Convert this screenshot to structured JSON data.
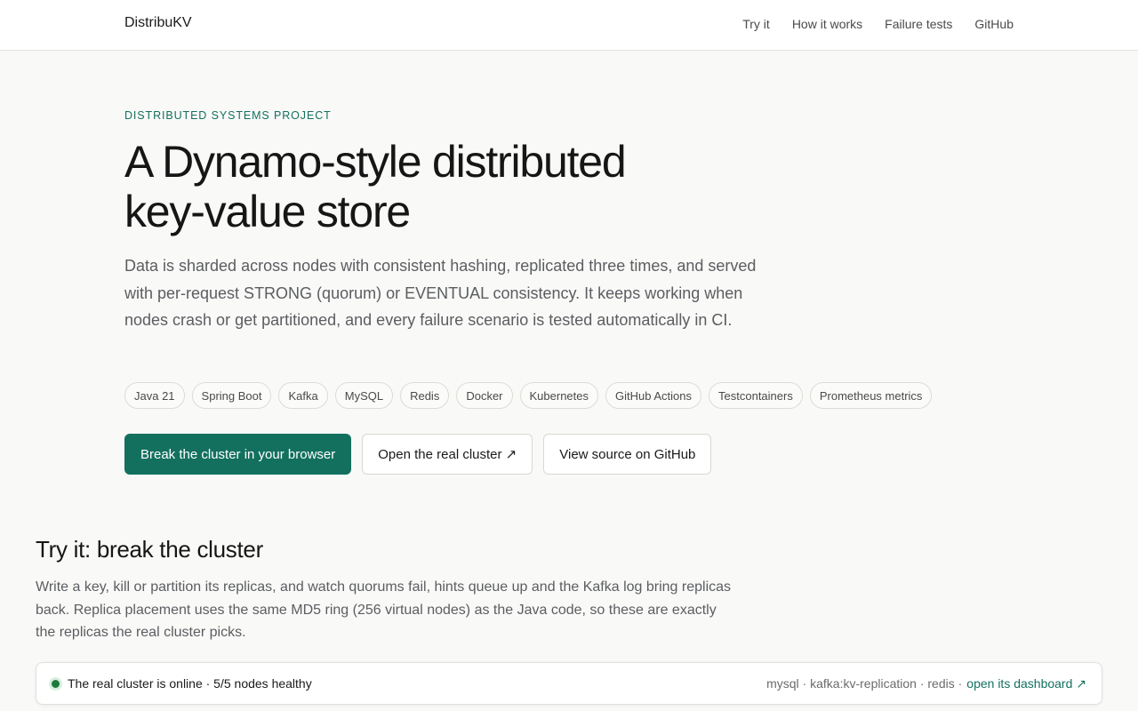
{
  "header": {
    "brand": "DistribuKV",
    "nav": [
      "Try it",
      "How it works",
      "Failure tests",
      "GitHub"
    ]
  },
  "hero": {
    "eyebrow": "DISTRIBUTED SYSTEMS PROJECT",
    "title_line1": "A Dynamo-style distributed",
    "title_line2": "key-value store",
    "lead": "Data is sharded across nodes with consistent hashing, replicated three times, and served with per-request STRONG (quorum) or EVENTUAL consistency. It keeps working when nodes crash or get partitioned, and every failure scenario is tested automatically in CI.",
    "tags": [
      "Java 21",
      "Spring Boot",
      "Kafka",
      "MySQL",
      "Redis",
      "Docker",
      "Kubernetes",
      "GitHub Actions",
      "Testcontainers",
      "Prometheus metrics"
    ],
    "cta_primary": "Break the cluster in your browser",
    "cta_cluster": "Open the real cluster ↗",
    "cta_github": "View source on GitHub"
  },
  "try_it": {
    "title": "Try it: break the cluster",
    "lead": "Write a key, kill or partition its replicas, and watch quorums fail, hints queue up and the Kafka log bring replicas back. Replica placement uses the same MD5 ring (256 virtual nodes) as the Java code, so these are exactly the replicas the real cluster picks.",
    "status": {
      "text": "The real cluster is online · 5/5 nodes healthy",
      "services": "mysql · kafka:kv-replication · redis ·",
      "dashboard_link": "open its dashboard ↗"
    }
  },
  "colors": {
    "accent": "#13705f",
    "status_ok": "#1e7a3c",
    "background": "#f9f9f7"
  }
}
